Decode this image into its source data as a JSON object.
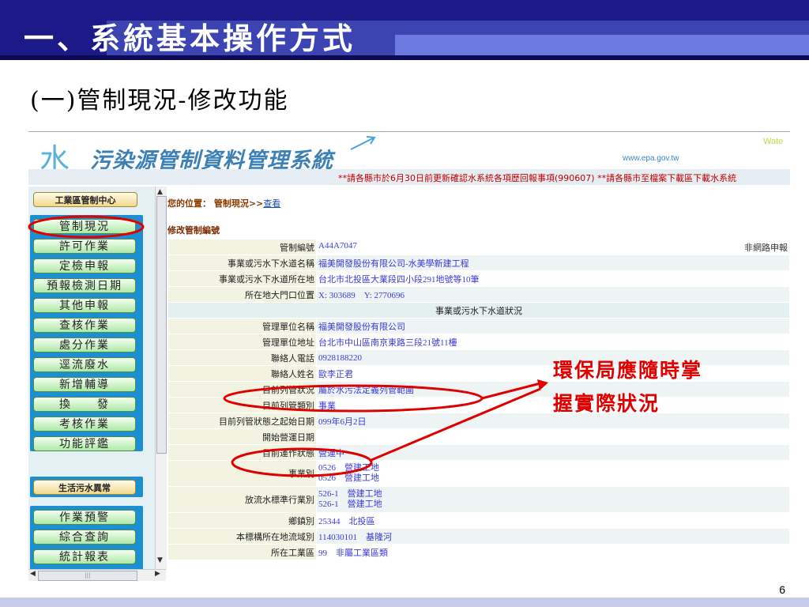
{
  "slide": {
    "title": "一、系統基本操作方式",
    "subtitle": "(一)管制現況-修改功能",
    "page_number": "6"
  },
  "banner": {
    "logo_water": "水",
    "logo_text": "污染源管制資料管理系統",
    "url": "www.epa.gov.tw",
    "corner_text": "Wate",
    "notice": "**請各縣市於6月30日前更新確認水系統各項歷回報事項(990607) **請各縣市至檔案下載區下載水系統"
  },
  "menu": {
    "top": "工業區管制中心",
    "group1": [
      "管制現況",
      "許可作業",
      "定檢申報",
      "預報檢測日期",
      "其他申報",
      "查核作業",
      "處分作業",
      "逕流廢水",
      "新增輔導",
      "換　　發",
      "考核作業",
      "功能評鑑"
    ],
    "mid": "生活污水異常",
    "group2": [
      "作業預警",
      "綜合查詢",
      "統計報表"
    ],
    "scroll_thumb": "|||"
  },
  "content": {
    "location_label": "您的位置： 管制現況>>",
    "location_link": "查看",
    "section_title": "修改管制編號",
    "rows": [
      {
        "label": "管制編號",
        "value": "A44A7047",
        "extra": "非網路申報"
      },
      {
        "label": "事業或污水下水道名稱",
        "value": "福美開發股份有限公司-水美學新建工程"
      },
      {
        "label": "事業或污水下水道所在地",
        "value": "台北市北投區大業段四小段291地號等10筆"
      },
      {
        "label": "所在地大門口位置",
        "value": "X: 303689　Y: 2770696"
      },
      {
        "section": "事業或污水下水道狀況"
      },
      {
        "label": "管理單位名稱",
        "value": "福美開發股份有限公司"
      },
      {
        "label": "管理單位地址",
        "value": "台北市中山區南京東路三段21號11樓"
      },
      {
        "label": "聯絡人電話",
        "value": "0928188220"
      },
      {
        "label": "聯絡人姓名",
        "value": "歐李正君"
      },
      {
        "label": "目前列管狀況",
        "value": "屬於水污法定義列管範圍"
      },
      {
        "label": "目前列管類別",
        "value": "事業"
      },
      {
        "label": "目前列管狀態之起始日期",
        "value": "099年6月2日"
      },
      {
        "label": "開始營運日期",
        "value": ""
      },
      {
        "label": "目前運作狀態",
        "value": "營運中"
      },
      {
        "label": "事業別",
        "value": "0526　營建工地",
        "value2": "0526　營建工地"
      },
      {
        "label": "放流水標準行業別",
        "value": "526-1　營建工地",
        "value2": "526-1　營建工地"
      },
      {
        "label": "鄉鎮別",
        "value": "25344　北投區"
      },
      {
        "label": "本標構所在地流域別",
        "value": "114030101　基隆河"
      },
      {
        "label": "所在工業區",
        "value": "99　非屬工業區類"
      }
    ]
  },
  "annotation": {
    "line1": "環保局應隨時掌",
    "line2": "握實際狀況"
  },
  "colors": {
    "header_dark": "#1c1a88",
    "annotation_red": "#e00000",
    "menu_blue": "#1b8fd2"
  }
}
